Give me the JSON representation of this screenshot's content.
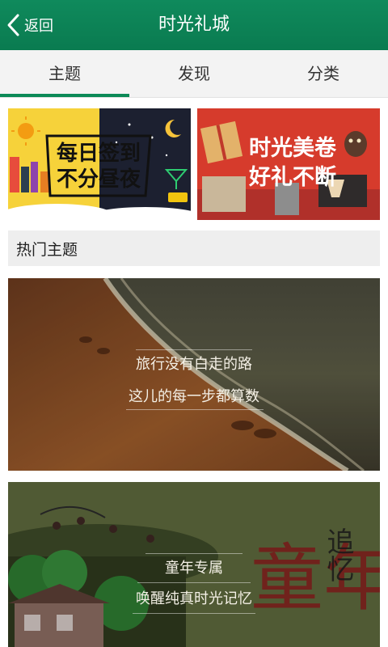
{
  "header": {
    "back_label": "返回",
    "title": "时光礼城"
  },
  "tabs": [
    {
      "label": "主题",
      "active": true
    },
    {
      "label": "发现",
      "active": false
    },
    {
      "label": "分类",
      "active": false
    }
  ],
  "banners": {
    "left": {
      "line1": "每日签到",
      "line2": "不分昼夜"
    },
    "right": {
      "line1": "时光美卷",
      "line2": "好礼不断"
    }
  },
  "section": {
    "title": "热门主题"
  },
  "cards": [
    {
      "line1": "旅行没有白走的路",
      "line2": "这儿的每一步都算数"
    },
    {
      "line1": "童年专属",
      "line2": "唤醒纯真时光记忆",
      "art_text_big": "童年",
      "art_text_small": "追忆"
    }
  ],
  "colors": {
    "header": "#0a7b50",
    "accent": "#0c8a57"
  }
}
